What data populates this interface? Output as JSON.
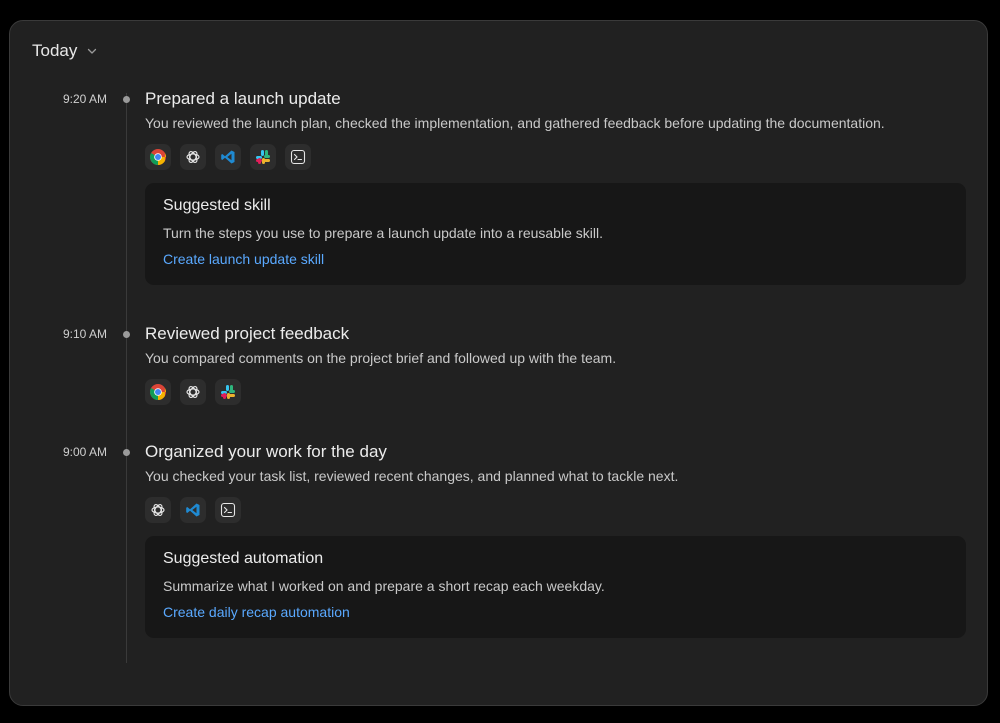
{
  "header": {
    "title": "Today"
  },
  "entries": [
    {
      "time": "9:20 AM",
      "title": "Prepared a launch update",
      "description": "You reviewed the launch plan, checked the implementation, and gathered feedback before updating the documentation.",
      "apps": [
        "chrome-icon",
        "chatgpt-icon",
        "vscode-icon",
        "slack-icon",
        "terminal-icon"
      ],
      "suggestion": {
        "title": "Suggested skill",
        "description": "Turn the steps you use to prepare a launch update into a reusable skill.",
        "link": "Create launch update skill"
      }
    },
    {
      "time": "9:10 AM",
      "title": "Reviewed project feedback",
      "description": "You compared comments on the project brief and followed up with the team.",
      "apps": [
        "chrome-icon",
        "chatgpt-icon",
        "slack-icon"
      ]
    },
    {
      "time": "9:00 AM",
      "title": "Organized your work for the day",
      "description": "You checked your task list, reviewed recent changes, and planned what to tackle next.",
      "apps": [
        "chatgpt-icon",
        "vscode-icon",
        "terminal-icon"
      ],
      "suggestion": {
        "title": "Suggested automation",
        "description": "Summarize what I worked on and prepare a short recap each weekday.",
        "link": "Create daily recap automation"
      }
    }
  ],
  "colors": {
    "background": "#000000",
    "panel": "#212121",
    "card": "#171717",
    "link": "#5aa9ff",
    "text": "#ececec",
    "muted": "#c9c9c9"
  }
}
